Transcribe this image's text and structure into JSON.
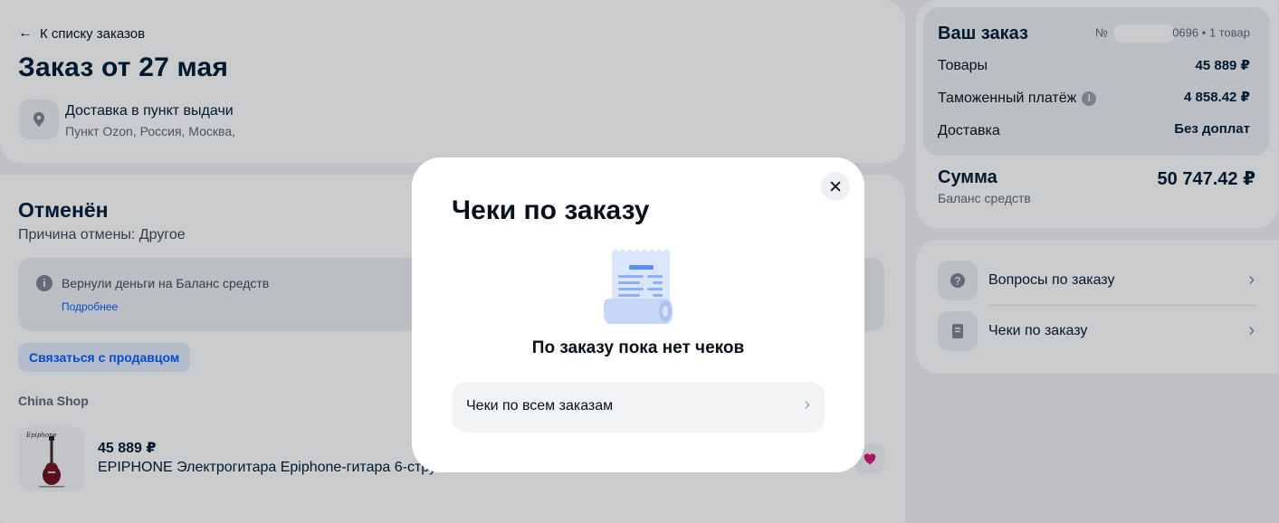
{
  "order": {
    "back_label": "К списку заказов",
    "title": "Заказ от 27 мая",
    "delivery_title": "Доставка в пункт выдачи",
    "delivery_address": "Пункт Ozon, Россия, Москва,"
  },
  "status": {
    "title": "Отменён",
    "reason": "Причина отмены: Другое",
    "refund_text": "Вернули деньги на Баланс средств",
    "more_link": "Подробнее",
    "contact_seller": "Связаться с продавцом"
  },
  "shop": {
    "name": "China Shop",
    "product": {
      "price": "45 889 ₽",
      "name": "EPIPHONE Электрогитара Epiphone-гитара 6-стру",
      "brand_logo_text": "Epiphone"
    }
  },
  "summary": {
    "title": "Ваш заказ",
    "number_prefix": "№",
    "number_suffix": "0696 • 1 товар",
    "rows": [
      {
        "label": "Товары",
        "value": "45 889 ₽"
      },
      {
        "label": "Таможенный платёж",
        "value": "4 858.42 ₽",
        "info": "i"
      },
      {
        "label": "Доставка",
        "value": "Без доплат"
      }
    ],
    "total_label": "Сумма",
    "total_sub": "Баланс средств",
    "total_value": "50 747.42 ₽"
  },
  "links": [
    {
      "label": "Вопросы по заказу",
      "icon": "question-icon"
    },
    {
      "label": "Чеки по заказу",
      "icon": "receipt-icon"
    }
  ],
  "modal": {
    "title": "Чеки по заказу",
    "empty_text": "По заказу пока нет чеков",
    "all_receipts": "Чеки по всем заказам"
  },
  "colors": {
    "accent": "#005bff",
    "text": "#07111b",
    "muted": "#5d6874",
    "favorite": "#d6197a"
  }
}
